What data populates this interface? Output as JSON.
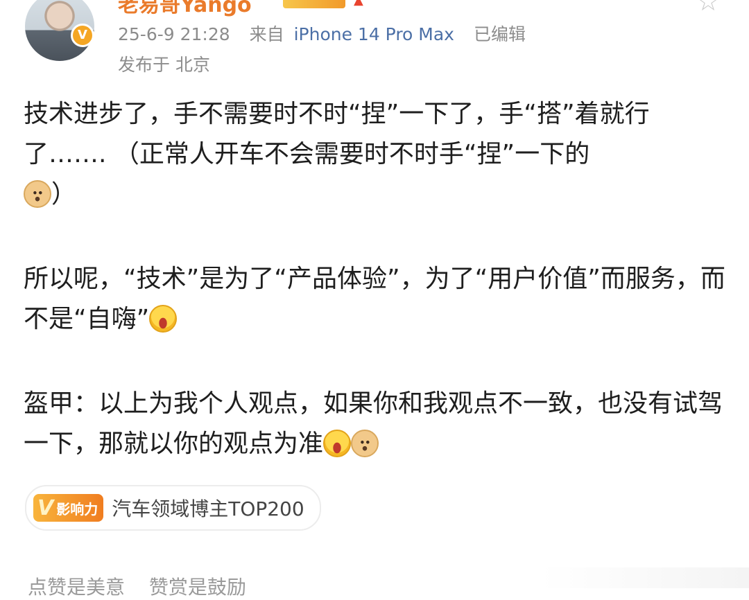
{
  "header": {
    "username": "老易哥Yango",
    "verified_mark": "V",
    "meta": {
      "time": "25-6-9 21:28",
      "source_prefix": "来自",
      "device": "iPhone 14 Pro Max",
      "edited": "已编辑"
    },
    "location": "发布于 北京",
    "favorite_glyph": "☆"
  },
  "post": {
    "paragraph1": "技术进步了，手不需要时不时“捏”一下了，手“搭”着就行了……. （正常人开车不会需要时不时手“捏”一下的",
    "paragraph1_end": "）",
    "paragraph2": "所以呢，“技术”是为了“产品体验”，为了“用户价值”而服务，而不是“自嗨”",
    "paragraph3": "盔甲：以上为我个人观点，如果你和我观点不一致，也没有试驾一下，那就以你的观点为准"
  },
  "influence": {
    "logo_mark": "V",
    "logo_label": "影响力",
    "tag_text": "汽车领域博主TOP200"
  },
  "footer": {
    "item1": "点赞是美意",
    "item2": "赞赏是鼓励"
  },
  "colors": {
    "username": "#ea7b2b",
    "link_blue": "#4b6fa6",
    "meta_gray": "#8c8c8c",
    "verify_orange": "#f5a623"
  },
  "icons": {
    "avatar": "avatar",
    "verified": "verified-badge-icon",
    "favorite": "star-outline-icon",
    "emoji_doge": "doge-emoji-icon",
    "emoji_laugh": "laughing-emoji-icon"
  }
}
